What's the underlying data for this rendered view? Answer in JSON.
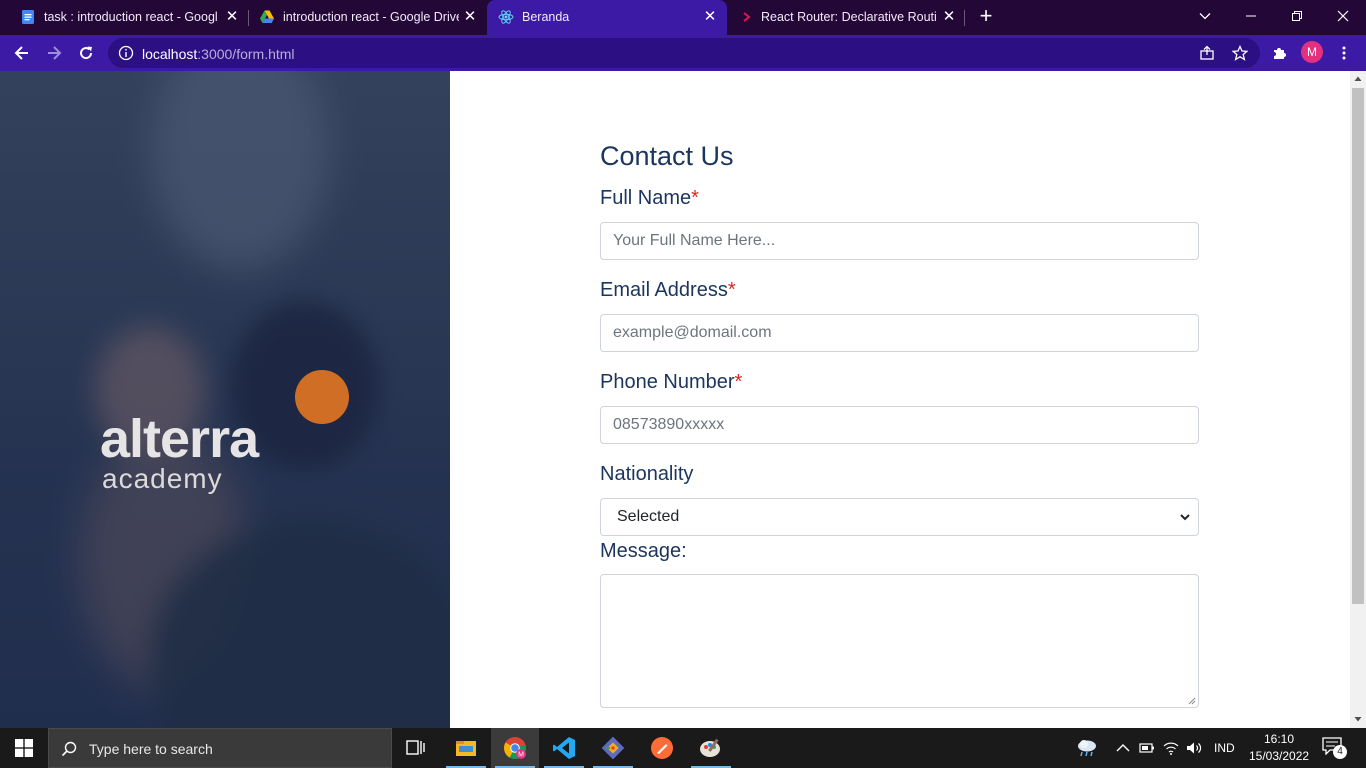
{
  "browser": {
    "tabs": [
      {
        "title": "task : introduction react - Google",
        "icon": "google-docs-icon",
        "active": false
      },
      {
        "title": "introduction react - Google Drive",
        "icon": "google-drive-icon",
        "active": false
      },
      {
        "title": "Beranda",
        "icon": "react-icon",
        "active": true
      },
      {
        "title": "React Router: Declarative Routing",
        "icon": "react-router-icon",
        "active": false
      }
    ],
    "url_host": "localhost",
    "url_path": ":3000/form.html",
    "profile_initial": "M",
    "colors": {
      "frame": "#230736",
      "toolbar": "#3c1aa6",
      "omnibox": "#2c0f83"
    }
  },
  "page": {
    "logo": {
      "word": "alterra",
      "sub": "academy",
      "accent": "#e07423"
    },
    "form": {
      "heading": "Contact Us",
      "required_mark": "*",
      "full_name": {
        "label": "Full Name",
        "placeholder": "Your Full Name Here..."
      },
      "email": {
        "label": "Email Address",
        "placeholder": "example@domail.com"
      },
      "phone": {
        "label": "Phone Number",
        "placeholder": "08573890xxxxx"
      },
      "nationality": {
        "label": "Nationality",
        "selected": "Selected"
      },
      "message": {
        "label": "Message:"
      }
    },
    "colors": {
      "label": "#1b355e",
      "required": "#e02424"
    }
  },
  "taskbar": {
    "search_placeholder": "Type here to search",
    "apps": [
      "task-view-icon",
      "file-explorer-icon",
      "chrome-icon",
      "vscode-icon",
      "git-icon",
      "postman-icon",
      "paint-icon"
    ],
    "language": "IND",
    "time": "16:10",
    "date": "15/03/2022",
    "notification_count": "4"
  }
}
